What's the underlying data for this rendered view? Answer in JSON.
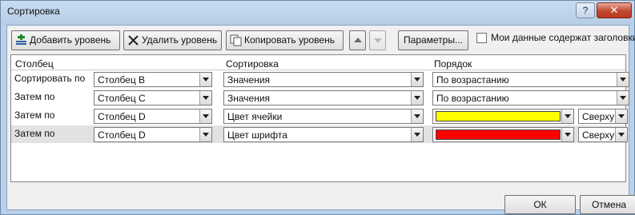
{
  "window": {
    "title": "Сортировка",
    "help_glyph": "?",
    "close_glyph": "✕"
  },
  "toolbar": {
    "add_level": "Добавить уровень",
    "delete_level": "Удалить уровень",
    "copy_level": "Копировать уровень",
    "options": "Параметры...",
    "headers_checkbox": {
      "label": "Мои данные содержат заголовки",
      "checked": false
    }
  },
  "columns": {
    "column": "Столбец",
    "sort_on": "Сортировка",
    "order": "Порядок"
  },
  "rows": [
    {
      "label": "Сортировать по",
      "column": "Столбец B",
      "sort_on": "Значения",
      "order": "По возрастанию",
      "order_color": null,
      "position": null
    },
    {
      "label": "Затем по",
      "column": "Столбец C",
      "sort_on": "Значения",
      "order": "По возрастанию",
      "order_color": null,
      "position": null
    },
    {
      "label": "Затем по",
      "column": "Столбец D",
      "sort_on": "Цвет ячейки",
      "order": null,
      "order_color": "#ffff00",
      "position": "Сверху"
    },
    {
      "label": "Затем по",
      "column": "Столбец D",
      "sort_on": "Цвет шрифта",
      "order": null,
      "order_color": "#ff0000",
      "position": "Сверху"
    }
  ],
  "selected_row": 3,
  "footer": {
    "ok": "ОК",
    "cancel": "Отмена"
  }
}
